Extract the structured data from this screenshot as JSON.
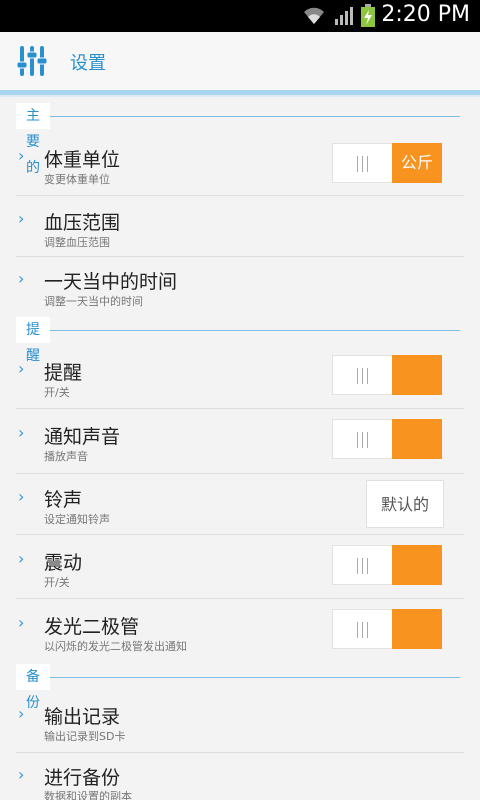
{
  "status_bar": {
    "time": "2:20 PM",
    "icons": [
      "wifi-icon",
      "signal-icon",
      "battery-charging-icon"
    ]
  },
  "app_bar": {
    "title": "设置",
    "icon": "settings-sliders-icon"
  },
  "sections": {
    "main": "主要的",
    "reminders": "提醒",
    "backup": "备份"
  },
  "items": {
    "weight_unit": {
      "title": "体重单位",
      "subtitle": "变更体重单位",
      "toggle_label": "公斤",
      "on": true
    },
    "bp_range": {
      "title": "血压范围",
      "subtitle": "调整血压范围"
    },
    "time_of_day": {
      "title": "一天当中的时间",
      "subtitle": "调整一天当中的时间"
    },
    "reminder": {
      "title": "提醒",
      "subtitle": "开/关",
      "on": true
    },
    "notify_sound": {
      "title": "通知声音",
      "subtitle": "播放声音",
      "on": true
    },
    "ringtone": {
      "title": "铃声",
      "subtitle": "设定通知铃声",
      "button": "默认的"
    },
    "vibrate": {
      "title": "震动",
      "subtitle": "开/关",
      "on": true
    },
    "led": {
      "title": "发光二极管",
      "subtitle": "以闪烁的发光二极管发出通知",
      "on": true
    },
    "export": {
      "title": "输出记录",
      "subtitle": "输出记录到SD卡"
    },
    "backup": {
      "title": "进行备份",
      "subtitle": "数据和设置的副本"
    }
  },
  "chevron": "›",
  "colors": {
    "accent_blue": "#2a8fcf",
    "toggle_orange": "#f7931e",
    "background": "#f3f3f3"
  }
}
